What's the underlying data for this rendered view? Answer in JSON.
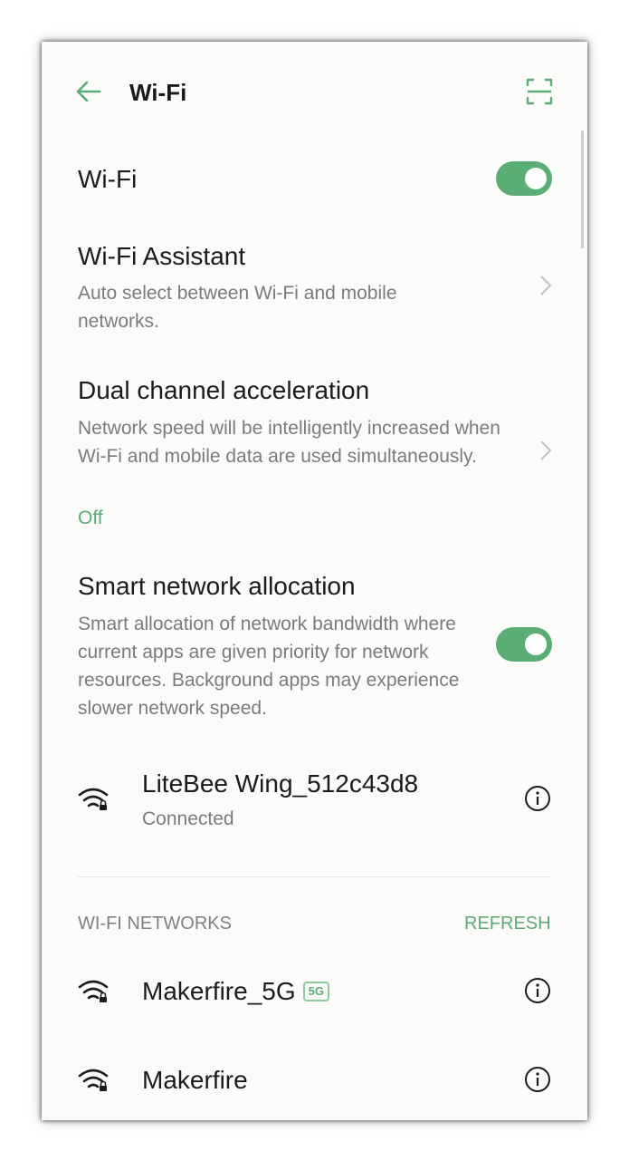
{
  "header": {
    "title": "Wi-Fi",
    "back_icon": "back-arrow-icon",
    "scan_icon": "qr-scan-icon"
  },
  "colors": {
    "accent": "#5aad74",
    "background": "#fbfbfa"
  },
  "wifi_toggle": {
    "label": "Wi-Fi",
    "on": true
  },
  "wifi_assistant": {
    "title": "Wi-Fi Assistant",
    "description": "Auto select between Wi-Fi and mobile networks."
  },
  "dual_channel": {
    "title": "Dual channel acceleration",
    "description": "Network speed will be intelligently increased when Wi-Fi and mobile data are used simultaneously.",
    "status": "Off"
  },
  "smart_network": {
    "title": "Smart network allocation",
    "description": "Smart allocation of network bandwidth where current apps are given priority for network resources. Background apps may experience slower network speed.",
    "on": true
  },
  "connected_network": {
    "name": "LiteBee Wing_512c43d8",
    "status": "Connected"
  },
  "networks_section": {
    "header": "WI-FI NETWORKS",
    "refresh_label": "REFRESH",
    "items": [
      {
        "name": "Makerfire_5G",
        "badge": "5G"
      },
      {
        "name": "Makerfire",
        "badge": ""
      }
    ]
  }
}
